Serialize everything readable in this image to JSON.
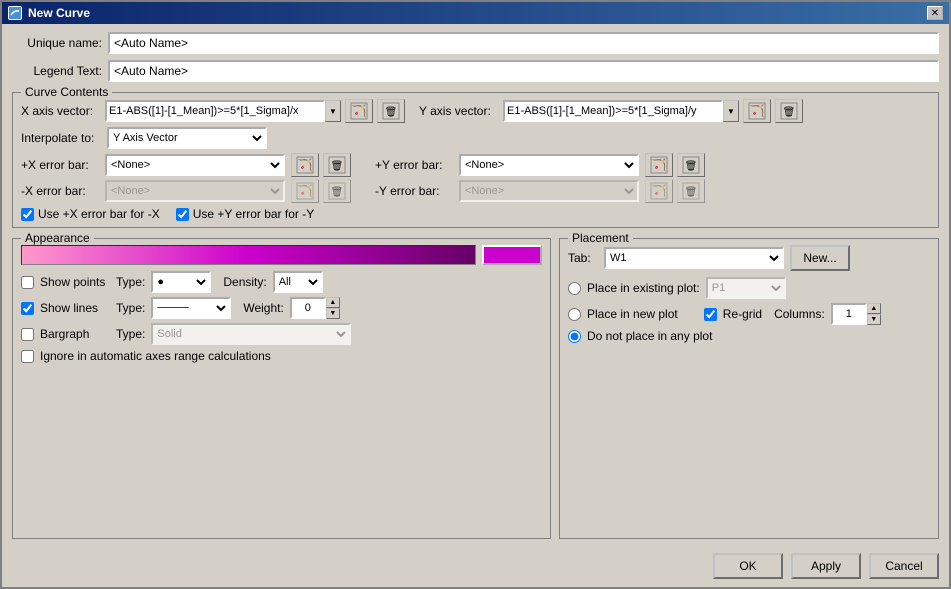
{
  "dialog": {
    "title": "New Curve",
    "icon": "C"
  },
  "unique_name": {
    "label": "Unique name:",
    "value": "<Auto Name>"
  },
  "legend_text": {
    "label": "Legend Text:",
    "value": "<Auto Name>"
  },
  "curve_contents": {
    "title": "Curve Contents",
    "x_axis_vector": {
      "label": "X axis vector:",
      "value": "E1-ABS([1]-[1_Mean])>=5*[1_Sigma]/x"
    },
    "y_axis_vector": {
      "label": "Y axis vector:",
      "value": "E1-ABS([1]-[1_Mean])>=5*[1_Sigma]/y"
    },
    "interpolate_to": {
      "label": "Interpolate to:",
      "value": "Y Axis Vector"
    },
    "x_error_bar": {
      "label": "+X error bar:",
      "value": "<None>"
    },
    "y_error_bar": {
      "label": "+Y error bar:",
      "value": "<None>"
    },
    "neg_x_error_bar": {
      "label": "-X error bar:",
      "value": "<None>"
    },
    "neg_y_error_bar": {
      "label": "-Y error bar:",
      "value": "<None>"
    },
    "use_x_error": "Use +X error bar for -X",
    "use_y_error": "Use +Y error bar for -Y"
  },
  "appearance": {
    "title": "Appearance",
    "show_points_label": "Show points",
    "type_label": "Type:",
    "density_label": "Density:",
    "density_value": "All",
    "show_lines_label": "Show lines",
    "lines_type_label": "Type:",
    "weight_label": "Weight:",
    "weight_value": "0",
    "bargraph_label": "Bargraph",
    "bargraph_type_label": "Type:",
    "bargraph_type_value": "Solid",
    "ignore_label": "Ignore in automatic axes range calculations"
  },
  "placement": {
    "title": "Placement",
    "tab_label": "Tab:",
    "tab_value": "W1",
    "new_btn": "New...",
    "place_existing": "Place in existing plot:",
    "existing_value": "P1",
    "place_new": "Place in new plot",
    "regrid_label": "Re-grid",
    "columns_label": "Columns:",
    "columns_value": "1",
    "no_place": "Do not place in any plot"
  },
  "buttons": {
    "ok": "OK",
    "apply": "Apply",
    "cancel": "Cancel"
  }
}
